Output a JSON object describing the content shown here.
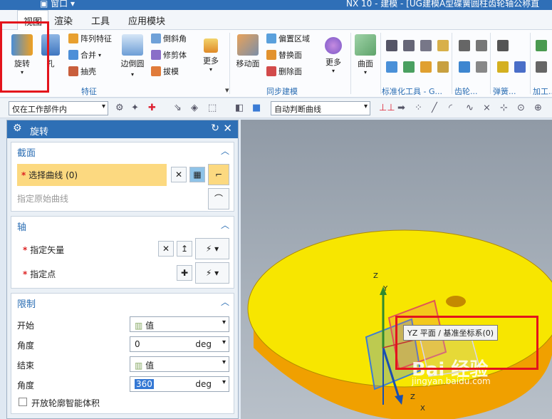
{
  "titlebar": {
    "quick_access": "▣ 窗口 ▾",
    "title": "NX 10 - 建模 - [UG建模A型碟簧圆柱齿轮轴公称直"
  },
  "menu": {
    "items": [
      {
        "label": "视图"
      },
      {
        "label": "渲染"
      },
      {
        "label": "工具"
      },
      {
        "label": "应用模块"
      }
    ]
  },
  "ribbon": {
    "feature": {
      "revolve_label": "旋转",
      "hole_label": "孔",
      "pattern_label": "阵列特征",
      "unite_label": "合并",
      "shell_label": "抽壳",
      "edge_blend_label": "边倒圆",
      "chamfer_label": "倒斜角",
      "trim_body_label": "修剪体",
      "draft_label": "拔模",
      "more_label": "更多",
      "group_label": "特征"
    },
    "sync": {
      "move_face_label": "移动面",
      "offset_region_label": "偏置区域",
      "replace_face_label": "替换面",
      "delete_face_label": "删除面",
      "more_label": "更多",
      "group_label": "同步建模"
    },
    "surface": {
      "surface_label": "曲面"
    },
    "groups": {
      "std_tools": "标准化工具 - G...",
      "gear": "齿轮...",
      "spring": "弹簧...",
      "process": "加工..."
    }
  },
  "toolbar": {
    "scope_select": "仅在工作部件内",
    "curve_rule_select": "自动判断曲线"
  },
  "dialog": {
    "title": "旋转",
    "section": {
      "title": "截面",
      "select_curve": "选择曲线 (0)",
      "specify_origin_curve": "指定原始曲线"
    },
    "axis": {
      "title": "轴",
      "specify_vector": "指定矢量",
      "specify_point": "指定点"
    },
    "limits": {
      "title": "限制",
      "start_label": "开始",
      "start_mode": "值",
      "angle_label_1": "角度",
      "start_angle": "0",
      "unit_1": "deg",
      "end_label": "结束",
      "end_mode": "值",
      "angle_label_2": "角度",
      "end_angle": "360",
      "unit_2": "deg",
      "open_profile_label": "开放轮廓智能体积"
    }
  },
  "viewport": {
    "tooltip": "YZ 平面 / 基准坐标系(0)",
    "axis_z_label": "Z",
    "axis_y_label": "Y",
    "axis_x_label": "X",
    "axis_z_label_2": "Z",
    "watermark": "Bai 经验",
    "watermark_url": "jingyan.baidu.com"
  },
  "colors": {
    "accent": "#2e6fb5",
    "highlight": "#fcd980",
    "callout": "#e3141c",
    "part_face": "#f7e600",
    "part_side": "#f0a000"
  }
}
